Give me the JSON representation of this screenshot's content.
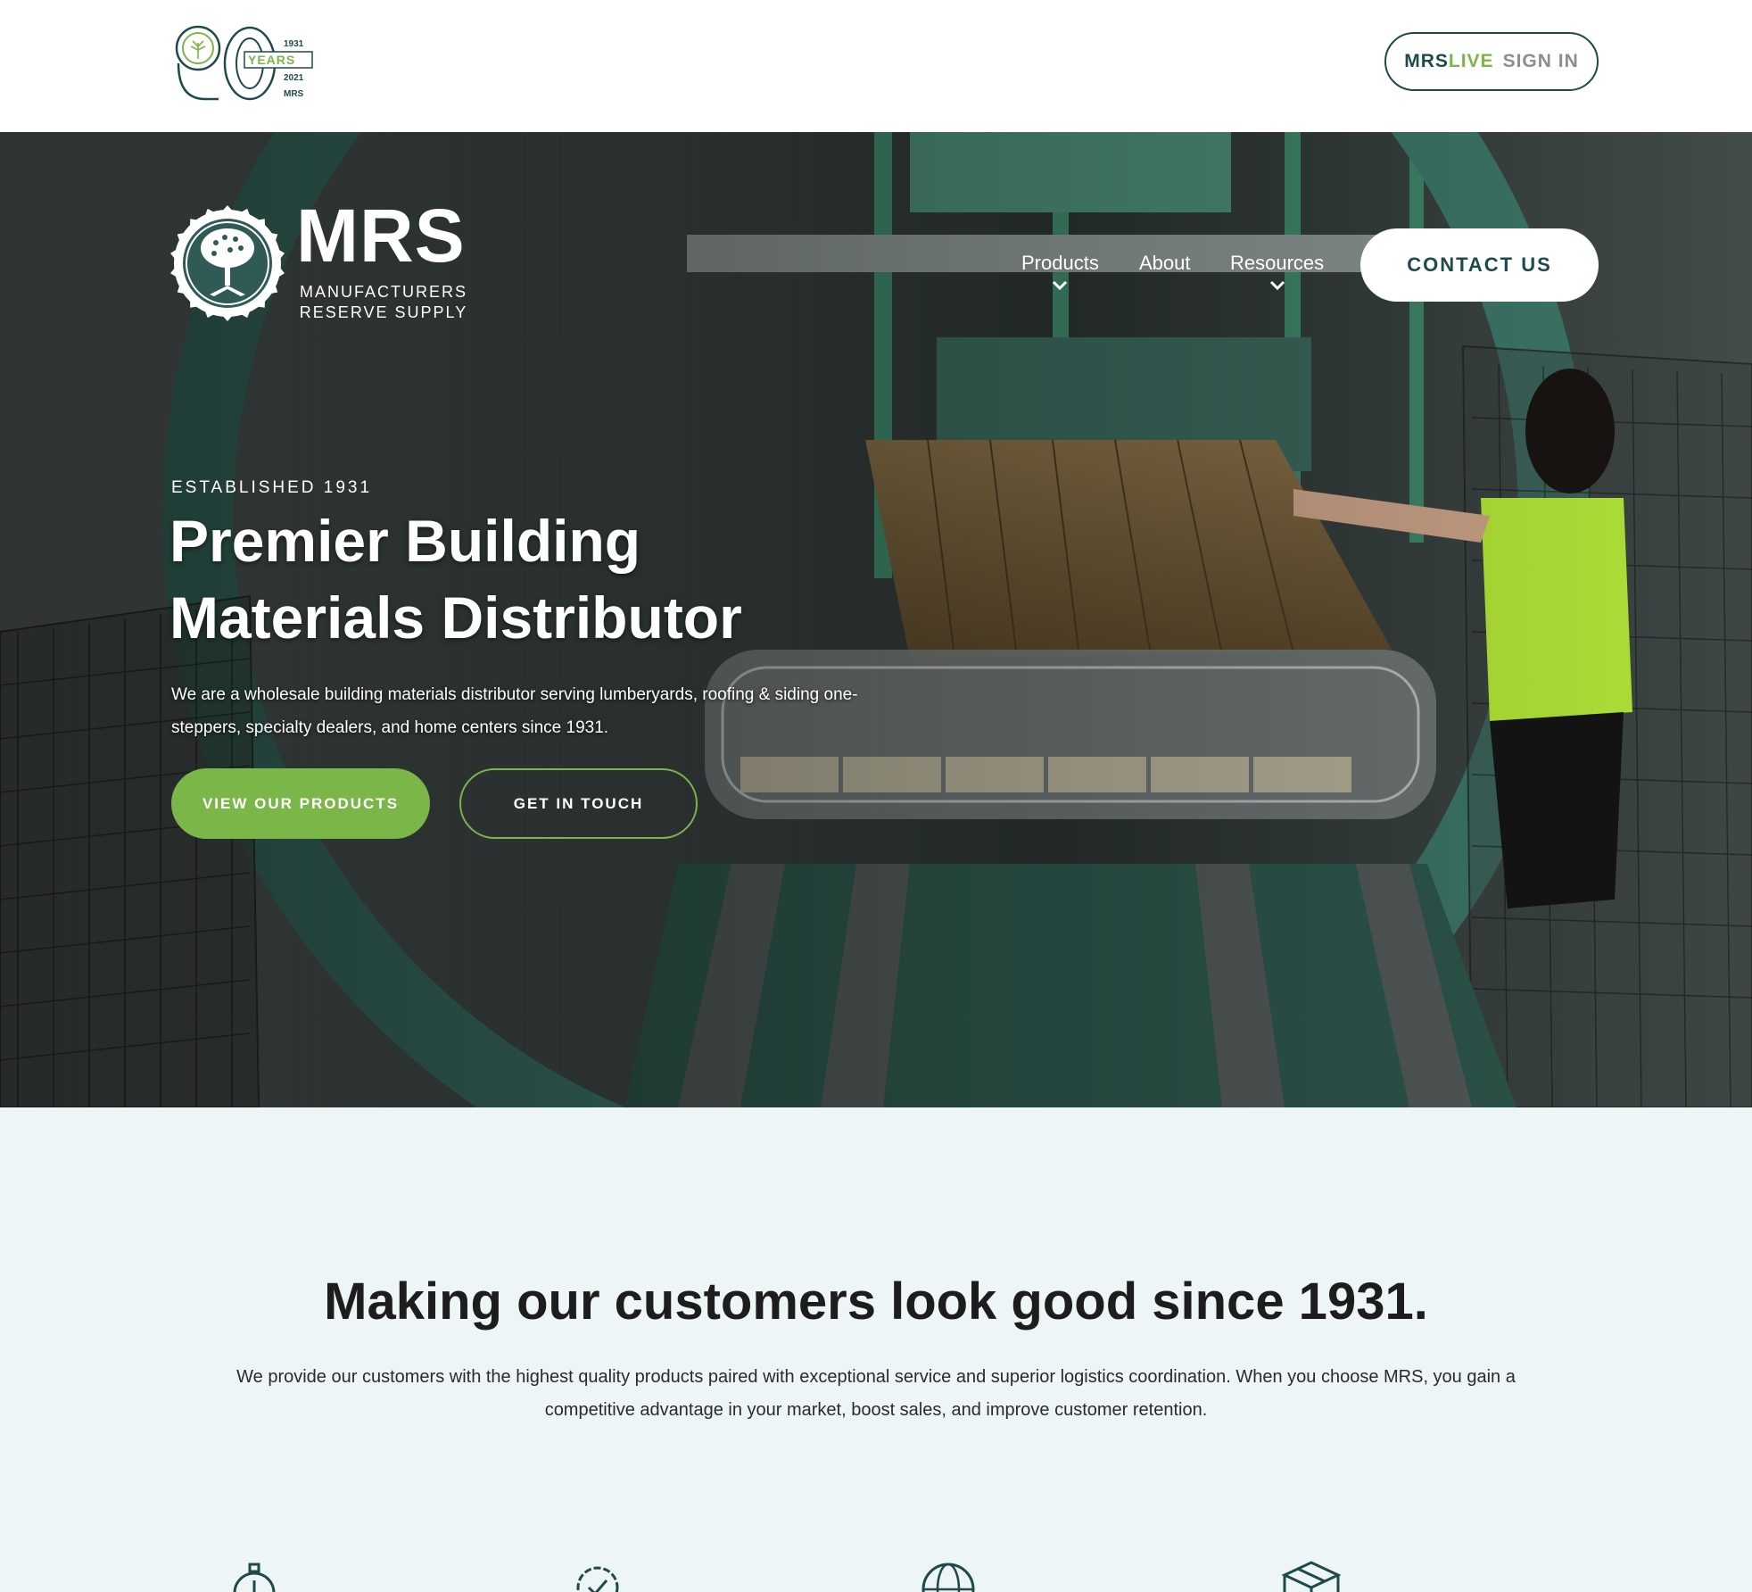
{
  "topbar": {
    "badge": {
      "big_number": "90",
      "years_label": "YEARS",
      "year_start": "1931",
      "year_end": "2021",
      "brand": "MRS"
    },
    "signin": {
      "mrs": "MRS",
      "live": "LIVE",
      "sign_in": "SIGN IN"
    }
  },
  "header": {
    "logo": {
      "name": "MRS",
      "subtitle_line1": "MANUFACTURERS",
      "subtitle_line2": "RESERVE SUPPLY"
    },
    "nav": [
      {
        "label": "Products",
        "has_dropdown": true
      },
      {
        "label": "About",
        "has_dropdown": false
      },
      {
        "label": "Resources",
        "has_dropdown": true
      }
    ],
    "contact_label": "CONTACT US"
  },
  "hero": {
    "eyebrow": "ESTABLISHED 1931",
    "title": "Premier Building Materials Distributor",
    "body": "We are a wholesale building materials distributor serving lumberyards, roofing & siding one-steppers, specialty dealers, and home centers since 1931.",
    "primary_button": "VIEW OUR PRODUCTS",
    "secondary_button": "GET IN TOUCH"
  },
  "intro": {
    "title": "Making our customers look good since 1931.",
    "body": "We provide our customers with the highest quality products paired with exceptional service and superior logistics coordination. When you choose MRS, you gain a competitive advantage in your market, boost sales, and improve customer retention."
  },
  "features": {
    "icons": [
      "stopwatch-icon",
      "quality-badge-icon",
      "globe-icon",
      "package-box-icon"
    ]
  },
  "colors": {
    "brand_green": "#7ab648",
    "brand_teal": "#1f4a4a",
    "section_bg": "#eef5f7"
  }
}
